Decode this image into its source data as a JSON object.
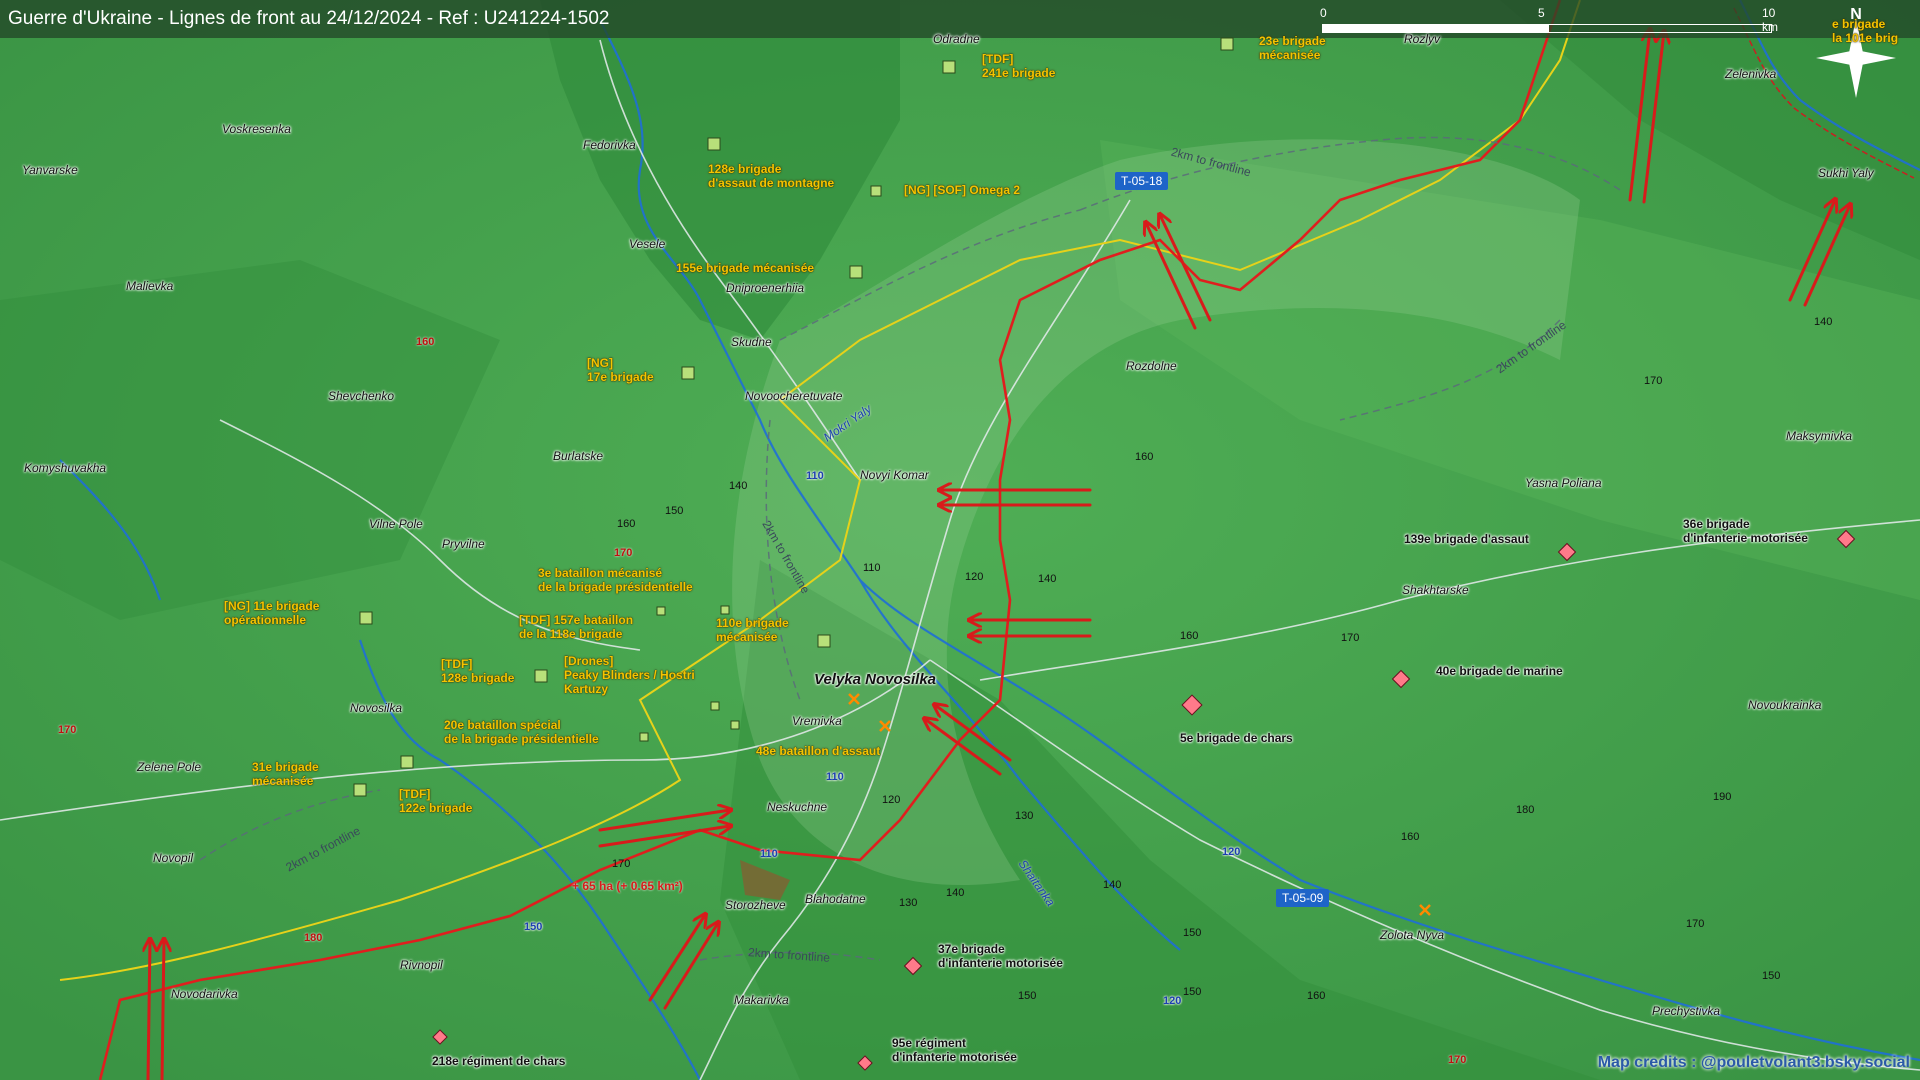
{
  "title": "Guerre d'Ukraine - Lignes de front au 24/12/2024 - Ref : U241224-1502",
  "scale": {
    "labels": [
      "0",
      "5",
      "10 km"
    ]
  },
  "north_label": "N",
  "credits": "Map credits : @pouletvolant3.bsky.social",
  "colors": {
    "frontline": "#e01e1e",
    "previous_line": "#e6d21a",
    "ua_unit": "#f5c400",
    "ru_unit": "#ff6a7a",
    "road_badge": "#1e64c8"
  },
  "towns": [
    "Voskresenka",
    "Yanvarske",
    "Fedorivka",
    "Odradne",
    "Veselе",
    "Malievka",
    "Dniproenerhiia",
    "Skudne",
    "Shevchenko",
    "Novoocheretuvate",
    "Komyshuvakha",
    "Burlatske",
    "Novyi Komar",
    "Vilne Pole",
    "Pryvilne",
    "Rozdolne",
    "Velyka Novosilka",
    "Vremivka",
    "Novosilka",
    "Zelene Pole",
    "Neskuchne",
    "Novopil",
    "Storozheve",
    "Blahodatne",
    "Rivnopil",
    "Novodarivka",
    "Makarivka",
    "Shakhtarske",
    "Yasna Poliana",
    "Maksymivka",
    "Novoukrainka",
    "Zolota Nyva",
    "Prechystivka",
    "Zelenivka",
    "Sukhi Yaly",
    "Rozlyv"
  ],
  "ua_units": [
    "[TDF]\n241e brigade",
    "23e brigade\nmécanisée",
    "128e brigade\nd'assaut de montagne",
    "[NG] [SOF] Omega 2",
    "155e brigade mécanisée",
    "[NG]\n17e brigade",
    "[NG] 11e brigade\nopérationnelle",
    "3e bataillon mécanisé\nde la brigade présidentielle",
    "[TDF] 157e bataillon\nde la 118e brigade",
    "110e brigade\nmécanisée",
    "[TDF]\n128e brigade",
    "[Drones]\nPeaky Blinders / Hostri\nKartuzy",
    "20e bataillon spécial\nde la brigade présidentielle",
    "48e bataillon d'assaut",
    "31e brigade\nmécanisée",
    "[TDF]\n122e brigade",
    "36e brigade\nd'infanterie motorisée",
    "e brigade\nla 101e brig"
  ],
  "ru_units": [
    "139e brigade d'assaut",
    "36e brigade\nd'infanterie motorisée",
    "40e brigade de marine",
    "5e brigade de chars",
    "37e brigade\nd'infanterie motorisée",
    "95e régiment\nd'infanterie motorisée",
    "218e régiment de chars"
  ],
  "roads": [
    "T-05-18",
    "T-05-09",
    "110",
    "110",
    "110",
    "120",
    "120",
    "150"
  ],
  "rivers": [
    "Mokri Yaly",
    "Shaitanka",
    "Sukhi Yaly"
  ],
  "distance_labels": [
    "2km to frontline",
    "2km to frontline",
    "2km to frontline",
    "2km to frontline",
    "2km to frontline"
  ],
  "gain_label": "+ 65 ha (+ 0.65 km²)",
  "elevations": [
    "160",
    "170",
    "170",
    "180",
    "150",
    "140",
    "160",
    "110",
    "120",
    "140",
    "160",
    "170",
    "160",
    "170",
    "130",
    "120",
    "140",
    "130",
    "150",
    "160",
    "140",
    "150",
    "180",
    "190",
    "160",
    "150",
    "170",
    "140",
    "170",
    "170",
    "150",
    "160"
  ]
}
